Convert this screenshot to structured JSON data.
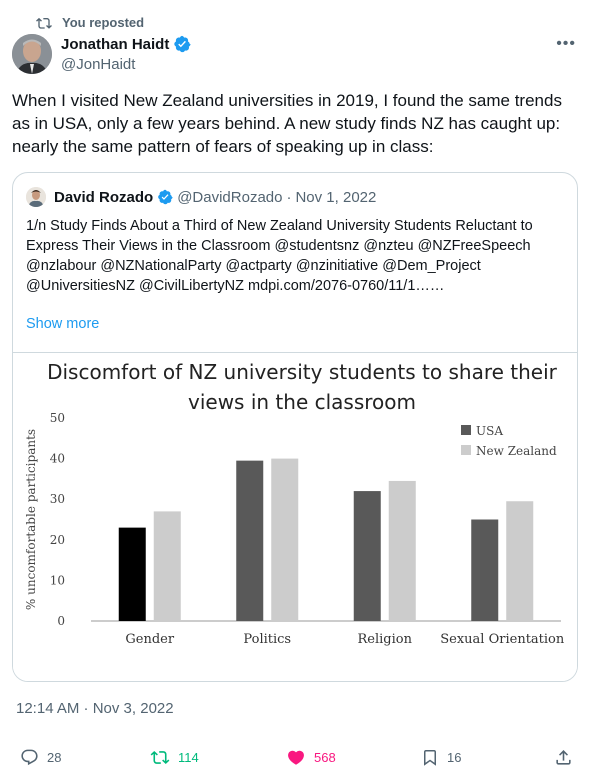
{
  "repost": {
    "label": "You reposted"
  },
  "author": {
    "name": "Jonathan Haidt",
    "handle": "@JonHaidt"
  },
  "tweet": {
    "text": "When I visited New Zealand universities in 2019, I found the same trends as in USA, only a few years behind. A new study finds NZ has caught up: nearly the same pattern of fears of speaking up in class:"
  },
  "quote": {
    "name": "David Rozado",
    "handle": "@DavidRozado",
    "separator": "·",
    "date": "Nov 1, 2022",
    "text": "1/n Study Finds About a Third of New Zealand University Students Reluctant to Express Their Views in the Classroom @studentsnz @nzteu @NZFreeSpeech @nzlabour @NZNationalParty @actparty @nzinitiative @Dem_Project @UniversitiesNZ @CivilLibertyNZ mdpi.com/2076-0760/11/1……",
    "show_more": "Show more"
  },
  "chart_data": {
    "type": "bar",
    "title": "Discomfort of NZ university students to share their views in the classroom",
    "title_lines": [
      "Discomfort of NZ university students to share their",
      "views in the classroom"
    ],
    "ylabel": "% uncomfortable participants",
    "ylim": [
      0,
      50
    ],
    "yticks": [
      "0",
      "10",
      "20",
      "30",
      "40",
      "50"
    ],
    "categories": [
      "Gender",
      "Politics",
      "Religion",
      "Sexual Orientation"
    ],
    "series": [
      {
        "name": "USA",
        "values": [
          23,
          39.5,
          32,
          25
        ],
        "color": "#595959"
      },
      {
        "name": "New Zealand",
        "values": [
          27,
          40,
          34.5,
          29.5
        ],
        "color": "#cccccc"
      }
    ],
    "highlight_color": "#000000",
    "grid": false,
    "legend": "top-right"
  },
  "timestamp": "12:14 AM · Nov 3, 2022",
  "actions": {
    "replies": "28",
    "reposts": "114",
    "likes": "568",
    "bookmarks": "16"
  },
  "colors": {
    "accent": "#1d9bf0",
    "repost": "#00ba7c",
    "like": "#f91880",
    "muted": "#536471"
  }
}
